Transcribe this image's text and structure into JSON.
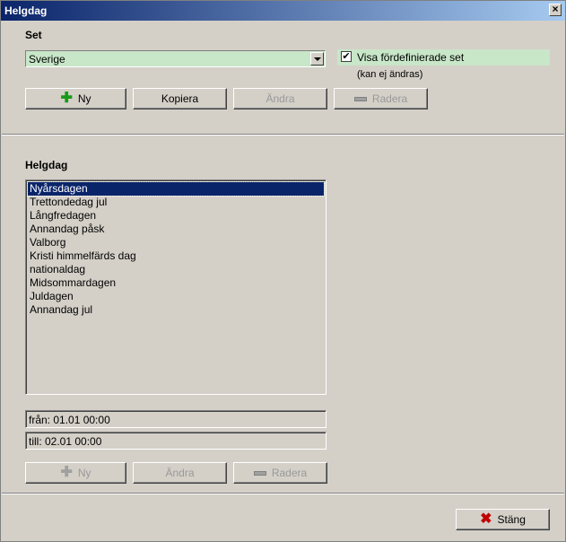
{
  "window": {
    "title": "Helgdag",
    "close_glyph": "×"
  },
  "set_section": {
    "label": "Set",
    "combo_value": "Sverige",
    "checkbox_checked": true,
    "checkbox_glyph": "✔",
    "checkbox_label": "Visa fördefinierade set",
    "note": "(kan ej ändras)",
    "buttons": {
      "new": "Ny",
      "copy": "Kopiera",
      "edit": "Ändra",
      "delete": "Radera"
    }
  },
  "holiday_section": {
    "label": "Helgdag",
    "items": [
      "Nyårsdagen",
      "Trettondedag jul",
      "Långfredagen",
      "Annandag påsk",
      "Valborg",
      "Kristi himmelfärds dag",
      "nationaldag",
      "Midsommardagen",
      "Juldagen",
      "Annandag jul"
    ],
    "selected_index": 0,
    "from_field": "från:  01.01  00:00",
    "to_field": "till:  02.01  00:00",
    "buttons": {
      "new": "Ny",
      "edit": "Ändra",
      "delete": "Radera"
    }
  },
  "footer": {
    "close_label": "Stäng"
  },
  "colors": {
    "highlight_green": "#c8e6c8",
    "selection": "#0a246a",
    "face": "#d4d0c8"
  },
  "icons": {
    "add": "plus-icon",
    "remove": "minus-icon",
    "close": "x-icon"
  }
}
